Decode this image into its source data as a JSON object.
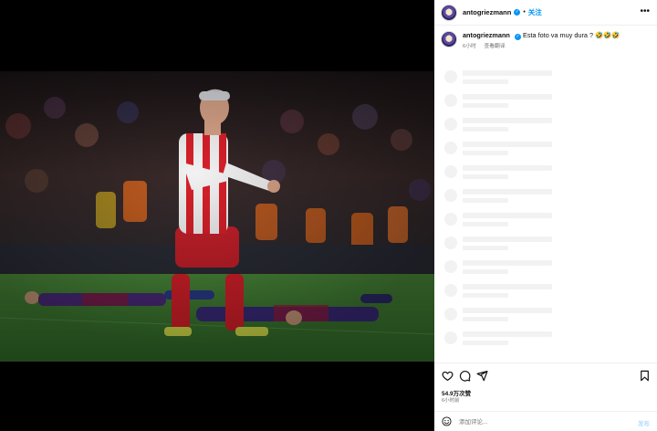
{
  "post": {
    "username": "antogriezmann",
    "follow_label": "关注",
    "separator": "•",
    "more_icon": "more-horizontal-icon",
    "photo_alt": "Griezmann celebrates on the pitch as Barcelona players lie on the grass"
  },
  "caption": {
    "username": "antogriezmann",
    "text": "Esta foto va muy dura ? 🤣🤣🤣",
    "time": "6小时",
    "translate_label": "查看翻译"
  },
  "skeleton_rows": 12,
  "actions": {
    "icons": [
      "heart-icon",
      "comment-icon",
      "share-icon",
      "bookmark-icon"
    ],
    "likes": "54.9万次赞",
    "time_ago": "6小时前"
  },
  "comment": {
    "placeholder": "添加评论...",
    "post_label": "发布",
    "emoji_icon": "emoji-icon"
  },
  "colors": {
    "accent": "#0095f6",
    "muted": "#737373",
    "divider": "#efefef",
    "post_disabled": "#b3dbff"
  }
}
